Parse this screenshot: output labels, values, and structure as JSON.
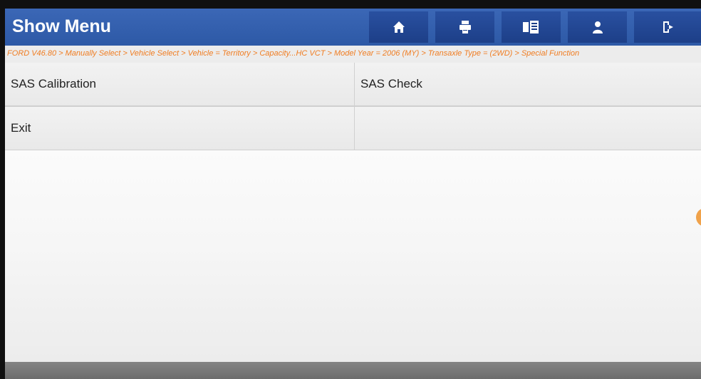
{
  "header": {
    "title": "Show Menu",
    "toolbar": [
      {
        "name": "home",
        "icon": "home-icon"
      },
      {
        "name": "print",
        "icon": "print-icon"
      },
      {
        "name": "report",
        "icon": "report-icon"
      },
      {
        "name": "user",
        "icon": "user-icon"
      },
      {
        "name": "exit",
        "icon": "exit-icon"
      }
    ]
  },
  "breadcrumb": {
    "text": "FORD V46.80 > Manually Select > Vehicle Select > Vehicle = Territory > Capacity...HC VCT > Model Year = 2006 (MY) > Transaxle Type = (2WD) > Special Function"
  },
  "menu": {
    "items": [
      {
        "label": "SAS Calibration"
      },
      {
        "label": "SAS Check"
      },
      {
        "label": "Exit"
      },
      {
        "label": ""
      }
    ]
  },
  "colors": {
    "header": "#2d59a6",
    "toolbar_button": "#1d3f88",
    "breadcrumb_text": "#f07d22",
    "side_handle": "#f0a24a"
  }
}
